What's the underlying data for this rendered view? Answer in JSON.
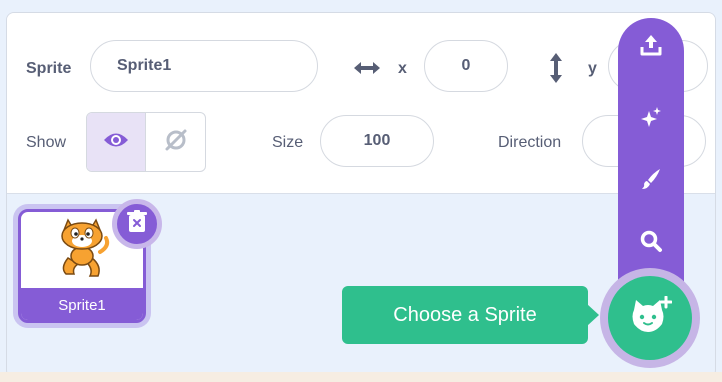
{
  "sprite_info": {
    "sprite_label": "Sprite",
    "sprite_name": "Sprite1",
    "x_label": "x",
    "x_value": "0",
    "y_label": "y",
    "show_label": "Show",
    "size_label": "Size",
    "size_value": "100",
    "direction_label": "Direction"
  },
  "sprite_list": {
    "selected_sprite_name": "Sprite1"
  },
  "sprite_menu": {
    "items": [
      "upload-icon",
      "surprise-icon",
      "paint-icon",
      "search-icon"
    ],
    "tooltip": "Choose a Sprite"
  },
  "colors": {
    "accent_purple": "#855cd6",
    "accent_green": "#2fbf8d",
    "panel_bg": "#e9f1fc",
    "text": "#575e75"
  }
}
